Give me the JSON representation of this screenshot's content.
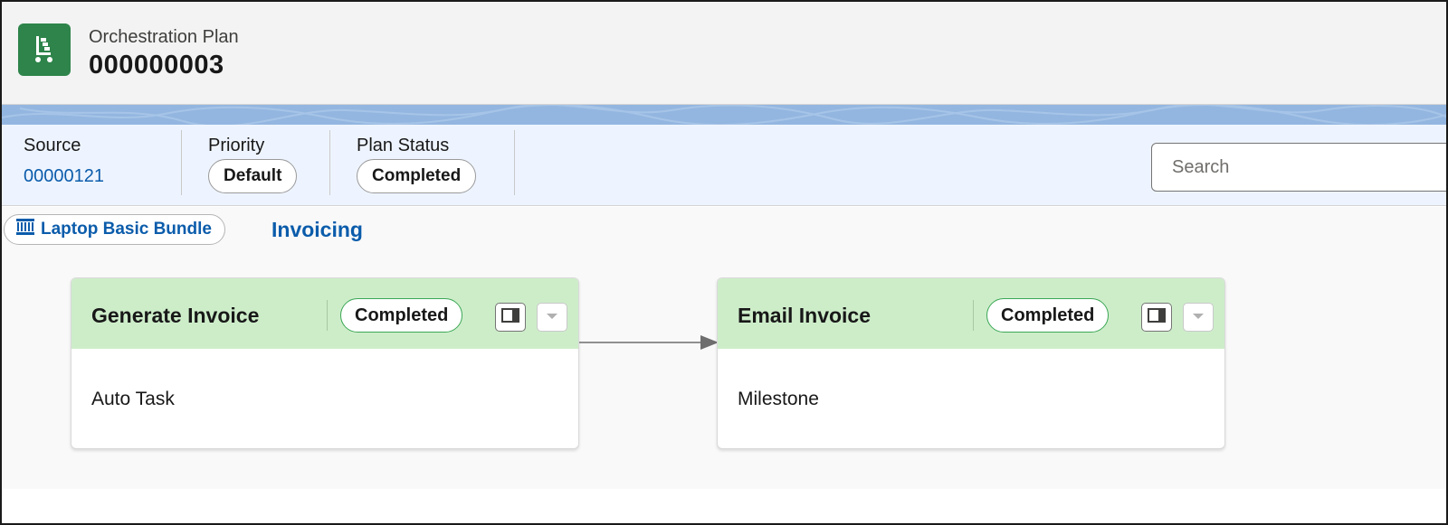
{
  "header": {
    "object_label": "Orchestration Plan",
    "record_name": "000000003",
    "icon": "orchestration-plan-icon",
    "icon_color": "#2e844a"
  },
  "highlights": {
    "source": {
      "label": "Source",
      "value": "00000121"
    },
    "priority": {
      "label": "Priority",
      "value": "Default"
    },
    "plan_status": {
      "label": "Plan Status",
      "value": "Completed"
    },
    "band_color": "#93b6e0",
    "background_color": "#eef4ff"
  },
  "search": {
    "placeholder": "Search",
    "icon": "search-icon"
  },
  "context": {
    "bundle_label": "Laptop Basic Bundle",
    "bundle_icon": "product-bundle-icon",
    "stage": "Invoicing",
    "link_color": "#0b5cab"
  },
  "steps": [
    {
      "title": "Generate Invoice",
      "status": "Completed",
      "type": "Auto Task"
    },
    {
      "title": "Email Invoice",
      "status": "Completed",
      "type": "Milestone"
    }
  ],
  "colors": {
    "card_header": "#cdedc9",
    "status_border": "#3ba755"
  }
}
